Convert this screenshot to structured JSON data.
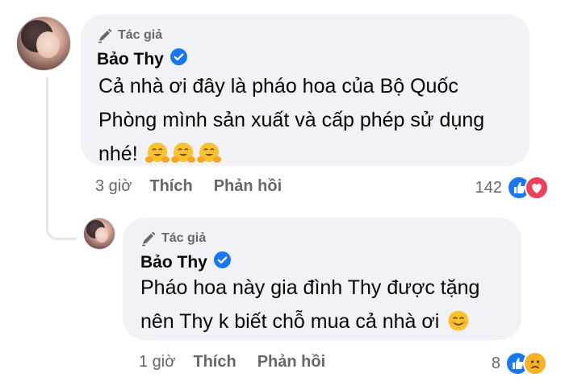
{
  "comments": [
    {
      "badge_label": "Tác giả",
      "author": "Bảo Thy",
      "text": "Cả nhà ơi đây là pháo hoa của Bộ Quốc Phòng mình sản xuất và cấp phép sử dụng nhé!",
      "emojis": [
        "hugging-face",
        "hugging-face",
        "hugging-face"
      ],
      "time": "3 giờ",
      "like_label": "Thích",
      "reply_label": "Phản hồi",
      "reaction_count": "142",
      "reactions": [
        "like",
        "love"
      ]
    },
    {
      "badge_label": "Tác giả",
      "author": "Bảo Thy",
      "text": "Pháo hoa này gia đình Thy được tặng nên Thy k biết chỗ mua cả nhà ơi",
      "emojis": [
        "smiling-face"
      ],
      "time": "1 giờ",
      "like_label": "Thích",
      "reply_label": "Phản hồi",
      "reaction_count": "8",
      "reactions": [
        "like",
        "sad"
      ]
    }
  ],
  "colors": {
    "bubble": "#f0f2f5",
    "muted": "#65676b",
    "verified": "#1877f2",
    "love": "#f33e58",
    "reaction_yellow": "#f7b125"
  }
}
